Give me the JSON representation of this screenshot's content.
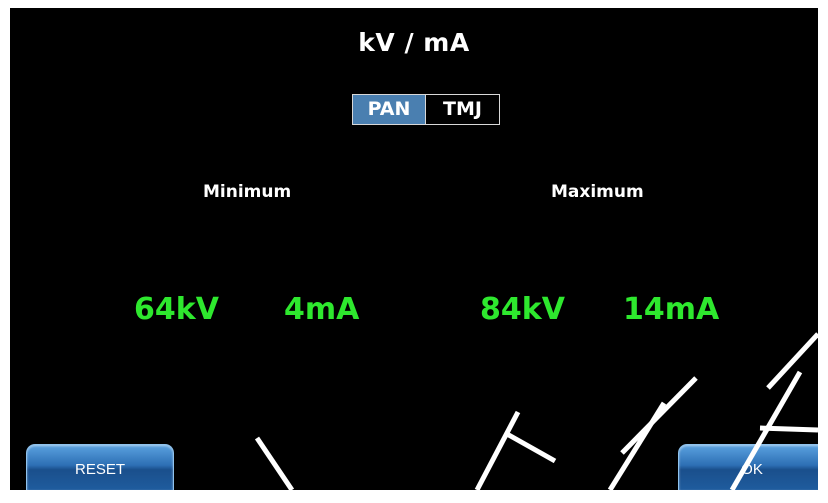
{
  "header": {
    "title": "kV / mA"
  },
  "mode_toggle": {
    "options": [
      "PAN",
      "TMJ"
    ],
    "selected": "PAN",
    "active_color": "#4a7fb0"
  },
  "minimum": {
    "label": "Minimum",
    "kv": "64kV",
    "ma": "4mA"
  },
  "maximum": {
    "label": "Maximum",
    "kv": "84kV",
    "ma": "14mA"
  },
  "buttons": {
    "reset_label": "RESET",
    "ok_label": "OK"
  },
  "colors": {
    "background": "#000000",
    "value_green": "#2ee82e",
    "button_blue": "#2d6fb4"
  }
}
